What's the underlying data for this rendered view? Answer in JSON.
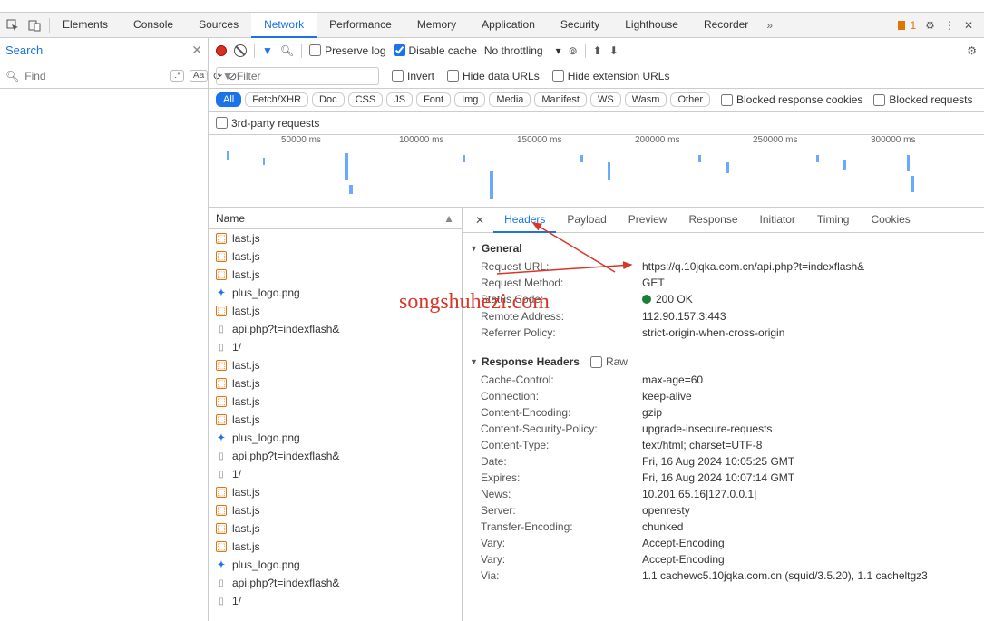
{
  "tabs": {
    "items": [
      "Elements",
      "Console",
      "Sources",
      "Network",
      "Performance",
      "Memory",
      "Application",
      "Security",
      "Lighthouse",
      "Recorder"
    ],
    "active": 3,
    "overflow": "»",
    "warn_count": "1"
  },
  "search": {
    "value": "Search",
    "find": "Find",
    "chip": ".*"
  },
  "toolbar": {
    "preserve": "Preserve log",
    "disable": "Disable cache",
    "throttle": "No throttling"
  },
  "filter": {
    "placeholder": "Filter",
    "invert": "Invert",
    "hidedata": "Hide data URLs",
    "hideext": "Hide extension URLs"
  },
  "pills": [
    "All",
    "Fetch/XHR",
    "Doc",
    "CSS",
    "JS",
    "Font",
    "Img",
    "Media",
    "Manifest",
    "WS",
    "Wasm",
    "Other"
  ],
  "pill_opts": {
    "blocked_cookies": "Blocked response cookies",
    "blocked_req": "Blocked requests"
  },
  "thirdparty": "3rd-party requests",
  "ticks": [
    "50000 ms",
    "100000 ms",
    "150000 ms",
    "200000 ms",
    "250000 ms",
    "300000 ms"
  ],
  "name_header": "Name",
  "requests": [
    {
      "ic": "js",
      "t": "last.js"
    },
    {
      "ic": "js",
      "t": "last.js"
    },
    {
      "ic": "js",
      "t": "last.js"
    },
    {
      "ic": "img",
      "t": "plus_logo.png"
    },
    {
      "ic": "js",
      "t": "last.js"
    },
    {
      "ic": "doc",
      "t": "api.php?t=indexflash&"
    },
    {
      "ic": "doc",
      "t": "1/"
    },
    {
      "ic": "js",
      "t": "last.js"
    },
    {
      "ic": "js",
      "t": "last.js"
    },
    {
      "ic": "js",
      "t": "last.js"
    },
    {
      "ic": "js",
      "t": "last.js"
    },
    {
      "ic": "img",
      "t": "plus_logo.png"
    },
    {
      "ic": "doc",
      "t": "api.php?t=indexflash&"
    },
    {
      "ic": "doc",
      "t": "1/"
    },
    {
      "ic": "js",
      "t": "last.js"
    },
    {
      "ic": "js",
      "t": "last.js"
    },
    {
      "ic": "js",
      "t": "last.js"
    },
    {
      "ic": "js",
      "t": "last.js"
    },
    {
      "ic": "img",
      "t": "plus_logo.png"
    },
    {
      "ic": "doc",
      "t": "api.php?t=indexflash&"
    },
    {
      "ic": "doc",
      "t": "1/"
    }
  ],
  "dtabs": [
    "Headers",
    "Payload",
    "Preview",
    "Response",
    "Initiator",
    "Timing",
    "Cookies"
  ],
  "general_label": "General",
  "general": [
    {
      "k": "Request URL:",
      "v": "https://q.10jqka.com.cn/api.php?t=indexflash&"
    },
    {
      "k": "Request Method:",
      "v": "GET"
    },
    {
      "k": "Status Code:",
      "v": "200 OK",
      "status": true
    },
    {
      "k": "Remote Address:",
      "v": "112.90.157.3:443"
    },
    {
      "k": "Referrer Policy:",
      "v": "strict-origin-when-cross-origin"
    }
  ],
  "resp_label": "Response Headers",
  "raw": "Raw",
  "response": [
    {
      "k": "Cache-Control:",
      "v": "max-age=60"
    },
    {
      "k": "Connection:",
      "v": "keep-alive"
    },
    {
      "k": "Content-Encoding:",
      "v": "gzip"
    },
    {
      "k": "Content-Security-Policy:",
      "v": "upgrade-insecure-requests"
    },
    {
      "k": "Content-Type:",
      "v": "text/html; charset=UTF-8"
    },
    {
      "k": "Date:",
      "v": "Fri, 16 Aug 2024 10:05:25 GMT"
    },
    {
      "k": "Expires:",
      "v": "Fri, 16 Aug 2024 10:07:14 GMT"
    },
    {
      "k": "News:",
      "v": "10.201.65.16|127.0.0.1|"
    },
    {
      "k": "Server:",
      "v": "openresty"
    },
    {
      "k": "Transfer-Encoding:",
      "v": "chunked"
    },
    {
      "k": "Vary:",
      "v": "Accept-Encoding"
    },
    {
      "k": "Vary:",
      "v": "Accept-Encoding"
    },
    {
      "k": "Via:",
      "v": "1.1 cachewc5.10jqka.com.cn (squid/3.5.20), 1.1 cacheltgz3"
    }
  ],
  "watermark": "songshuhezi.com"
}
